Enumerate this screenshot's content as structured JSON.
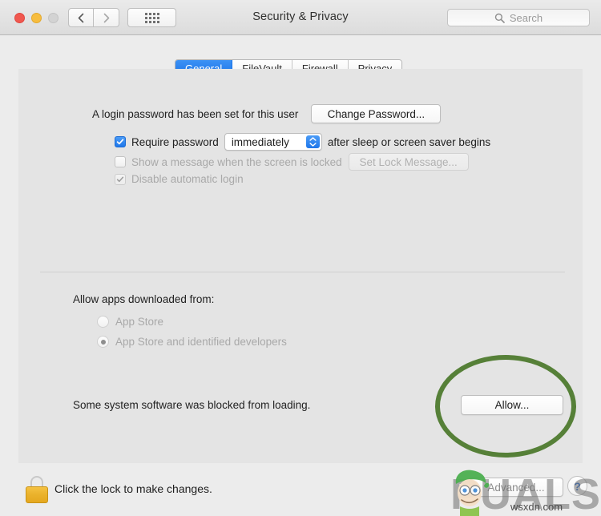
{
  "window": {
    "title": "Security & Privacy",
    "traffic_lights": [
      "close",
      "minimize",
      "zoom"
    ],
    "nav": {
      "back": "back-arrow",
      "forward": "forward-arrow",
      "show_all": "grid-icon"
    },
    "search": {
      "placeholder": "Search",
      "value": "",
      "icon": "search-icon"
    }
  },
  "tabs": [
    {
      "label": "General",
      "active": true
    },
    {
      "label": "FileVault",
      "active": false
    },
    {
      "label": "Firewall",
      "active": false
    },
    {
      "label": "Privacy",
      "active": false
    }
  ],
  "general": {
    "login_password_text": "A login password has been set for this user",
    "change_password_button": "Change Password...",
    "require_password": {
      "checked": true,
      "enabled": true,
      "label": "Require password",
      "interval_value": "immediately",
      "suffix": "after sleep or screen saver begins"
    },
    "show_message": {
      "checked": false,
      "enabled": false,
      "label": "Show a message when the screen is locked",
      "button": "Set Lock Message..."
    },
    "disable_auto_login": {
      "checked": true,
      "enabled": false,
      "label": "Disable automatic login"
    },
    "allow_apps_heading": "Allow apps downloaded from:",
    "allow_apps_options": [
      {
        "label": "App Store",
        "selected": false,
        "enabled": false
      },
      {
        "label": "App Store and identified developers",
        "selected": true,
        "enabled": false
      }
    ],
    "blocked_software_text": "Some system software was blocked from loading.",
    "allow_button": "Allow..."
  },
  "bottom": {
    "lock_icon": "padlock-closed-icon",
    "lock_text": "Click the lock to make changes.",
    "advanced_button": "Advanced...",
    "help_button": "?"
  },
  "annotation": {
    "shape": "ellipse",
    "color": "#4a7729",
    "target": "allow-button"
  },
  "watermarks": {
    "brand": "PUALS",
    "url": "wsxdn.com"
  }
}
